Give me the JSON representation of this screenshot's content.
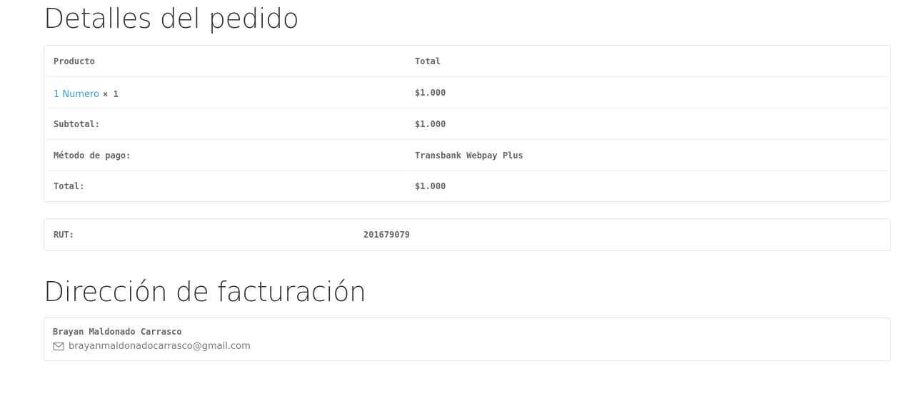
{
  "order_details": {
    "title": "Detalles del pedido",
    "header": {
      "product": "Producto",
      "total": "Total"
    },
    "item": {
      "name": "1 Numero",
      "quantity": "× 1",
      "total": "$1.000"
    },
    "summary": [
      {
        "label": "Subtotal:",
        "value": "$1.000"
      },
      {
        "label": "Método de pago:",
        "value": "Transbank Webpay Plus"
      },
      {
        "label": "Total:",
        "value": "$1.000"
      }
    ]
  },
  "rut": {
    "label": "RUT:",
    "value": "201679079"
  },
  "billing": {
    "title": "Dirección de facturación",
    "name": "Brayan Maldonado Carrasco",
    "email": "brayanmaldonadocarrasco@gmail.com",
    "email_icon": "envelope-icon"
  },
  "colors": {
    "link": "#3a9fd8",
    "border": "#e6e6e6",
    "heading": "#2f2f2f"
  }
}
